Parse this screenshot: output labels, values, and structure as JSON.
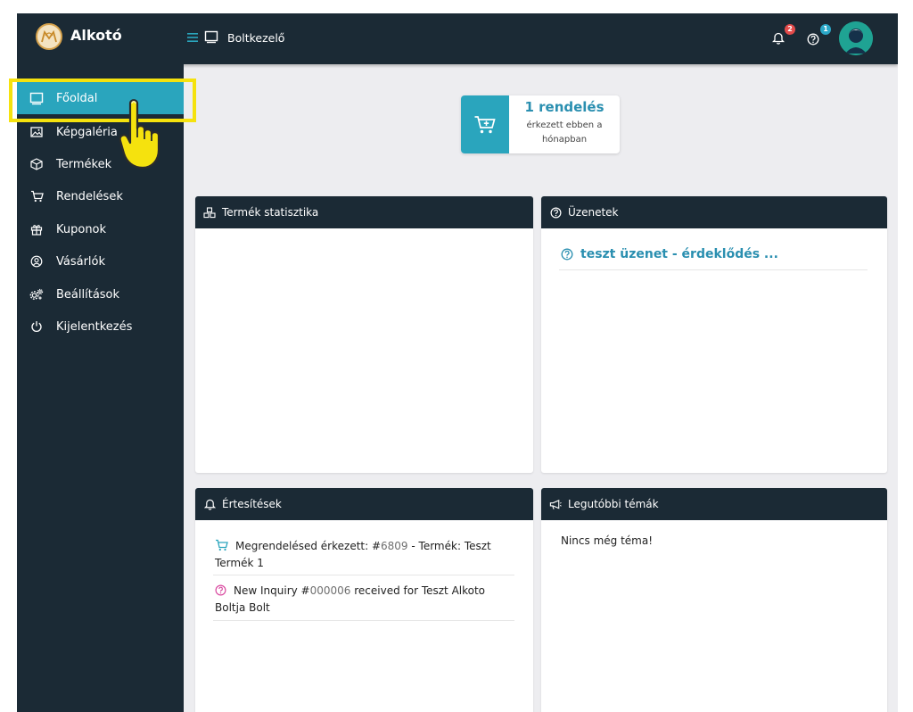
{
  "header": {
    "brand": "Alkotó",
    "section": "Boltkezelő",
    "notifications_count": "2",
    "help_count": "1"
  },
  "sidebar": {
    "items": [
      {
        "label": "Főoldal",
        "icon": "monitor-icon",
        "active": true
      },
      {
        "label": "Képgaléria",
        "icon": "image-icon"
      },
      {
        "label": "Termékek",
        "icon": "box-icon"
      },
      {
        "label": "Rendelések",
        "icon": "cart-icon"
      },
      {
        "label": "Kuponok",
        "icon": "gift-icon"
      },
      {
        "label": "Vásárlók",
        "icon": "user-circle-icon"
      },
      {
        "label": "Beállítások",
        "icon": "gears-icon"
      },
      {
        "label": "Kijelentkezés",
        "icon": "power-icon"
      }
    ]
  },
  "stat_card": {
    "title": "1 rendelés",
    "subtitle": "érkezett ebben a hónapban"
  },
  "panels": {
    "product_stats": {
      "title": "Termék statisztika"
    },
    "messages": {
      "title": "Üzenetek",
      "items": [
        "teszt üzenet - érdeklődés ..."
      ]
    },
    "notifications": {
      "title": "Értesítések",
      "items": [
        {
          "icon": "cart-icon",
          "prefix": "Megrendelésed érkezett: #",
          "number": "6809",
          "suffix": " - Termék: Teszt Termék 1"
        },
        {
          "icon": "question-icon",
          "prefix": "New Inquiry #",
          "number": "000006",
          "suffix": " received for Teszt Alkoto Boltja Bolt"
        }
      ]
    },
    "latest_topics": {
      "title": "Legutóbbi témák",
      "empty_text": "Nincs még téma!"
    }
  },
  "colors": {
    "dark": "#1b2a35",
    "accent": "#2aa5bd",
    "link": "#2a8fb0",
    "highlight": "#f5e20e",
    "badge_red": "#e34b4b",
    "badge_blue": "#2ba7c7"
  }
}
